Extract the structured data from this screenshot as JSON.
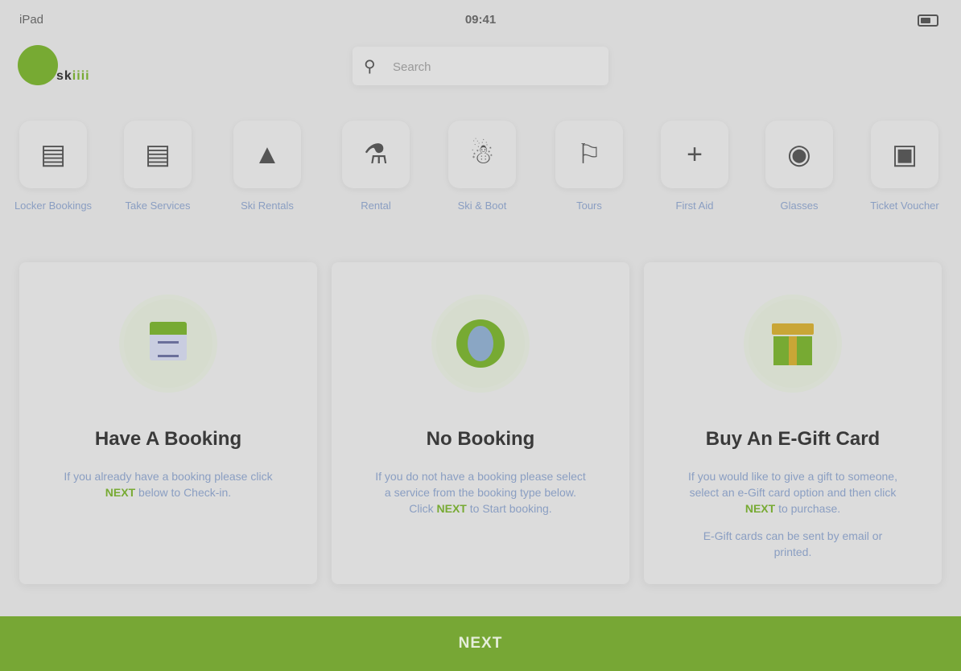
{
  "status_bar": {
    "carrier": "iPad",
    "time": "09:41"
  },
  "logo": {
    "text_dark": "sk",
    "text_green": "iiii"
  },
  "search": {
    "placeholder": "Search"
  },
  "categories": [
    {
      "label": "Locker Bookings",
      "icon": "locker-icon"
    },
    {
      "label": "Take Services",
      "icon": "ticket-icon"
    },
    {
      "label": "Ski Rentals",
      "icon": "ski-icon"
    },
    {
      "label": "Rental",
      "icon": "rental-icon"
    },
    {
      "label": "Ski & Boot",
      "icon": "boot-icon"
    },
    {
      "label": "Tours",
      "icon": "tour-icon"
    },
    {
      "label": "First Aid",
      "icon": "plus-icon"
    },
    {
      "label": "Glasses",
      "icon": "glasses-icon"
    },
    {
      "label": "Ticket Voucher",
      "icon": "voucher-icon"
    }
  ],
  "cards": [
    {
      "title": "Have A Booking",
      "desc_before": "If you already have a booking please click",
      "desc_highlight": "NEXT",
      "desc_after": "below to Check-in.",
      "desc2": "",
      "icon": "calendar-icon"
    },
    {
      "title": "No Booking",
      "desc_before": "If you do not have a booking please select a service from the booking type below. Click",
      "desc_highlight": "NEXT",
      "desc_after": "to Start booking.",
      "desc2": "",
      "icon": "globe-icon"
    },
    {
      "title": "Buy An E-Gift Card",
      "desc_before": "If you would like to give a gift to someone, select an e-Gift card option and then click",
      "desc_highlight": "NEXT",
      "desc_after": "to purchase.",
      "desc2": "E-Gift cards can be sent by email or printed.",
      "icon": "gift-icon"
    }
  ],
  "next_button": {
    "label": "NEXT"
  }
}
